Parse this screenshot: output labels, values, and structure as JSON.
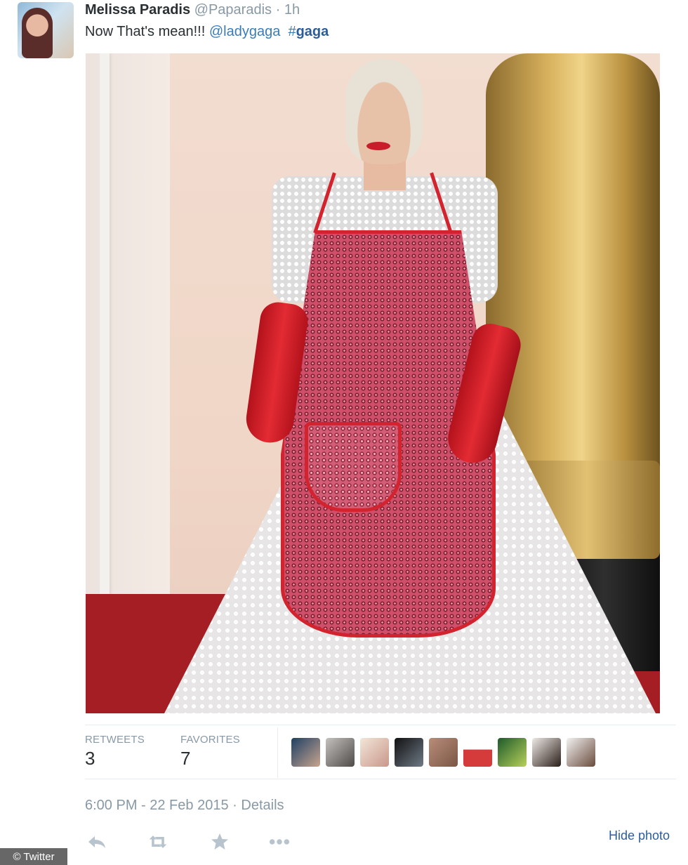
{
  "tweet": {
    "author_name": "Melissa Paradis",
    "author_handle": "@Paparadis",
    "separator": "·",
    "time_ago": "1h",
    "text_plain": "Now That's mean!!! ",
    "mention": "@ladygaga",
    "hashtag_symbol": "#",
    "hashtag_word": "gaga",
    "photo_icon": "photo-attachment"
  },
  "stats": {
    "retweets_label": "RETWEETS",
    "retweets_count": "3",
    "favorites_label": "FAVORITES",
    "favorites_count": "7",
    "favorited_by_count": 9
  },
  "meta": {
    "timestamp": "6:00 PM - 22 Feb 2015",
    "separator": "·",
    "details_label": "Details"
  },
  "actions": {
    "reply_icon": "reply-icon",
    "retweet_icon": "retweet-icon",
    "favorite_icon": "star-icon",
    "more_icon": "more-icon",
    "hide_photo_label": "Hide photo"
  },
  "watermark": {
    "text": "© Twitter"
  },
  "colors": {
    "link": "#3b7cb8",
    "hashtag": "#2b5d9b",
    "muted": "#8899a6",
    "text": "#292f33",
    "icon": "#b8c4cd",
    "border": "#e6ecf0"
  }
}
